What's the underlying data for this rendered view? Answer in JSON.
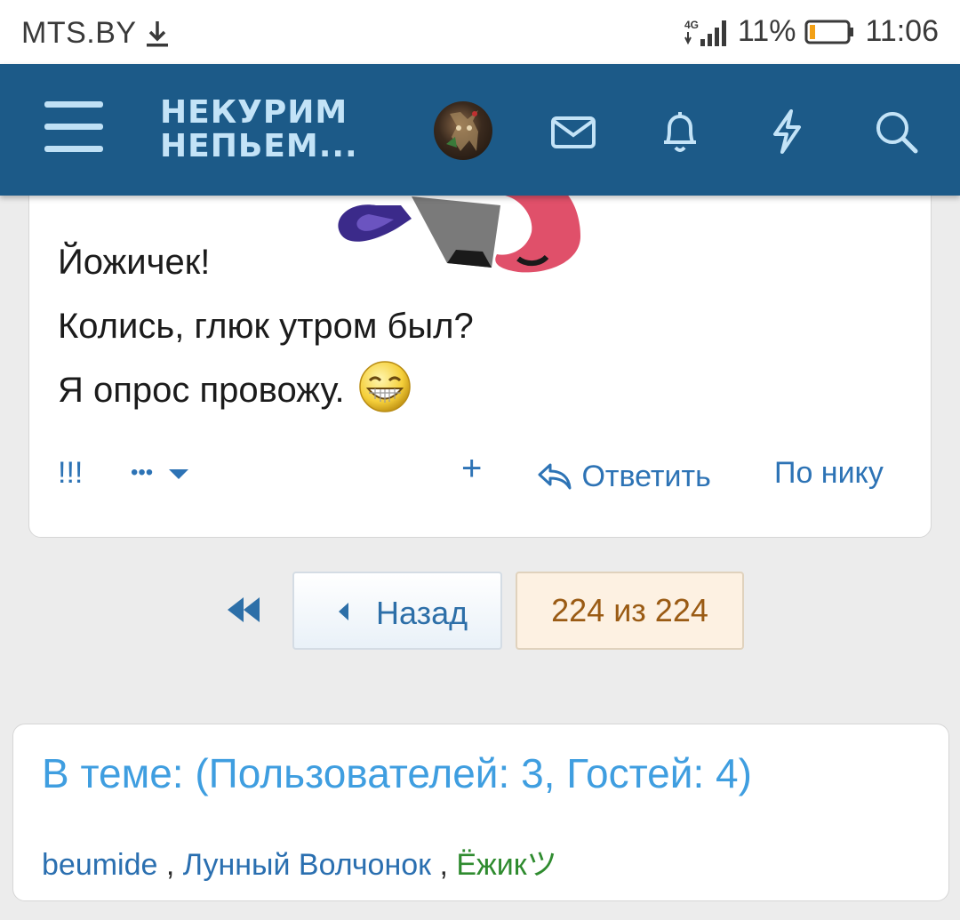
{
  "status_bar": {
    "carrier": "MTS.BY",
    "network": "4G",
    "battery_pct": "11%",
    "battery_level": 0.11,
    "time": "11:06"
  },
  "header": {
    "logo_line1": "НЕКУРИМ",
    "logo_line2": "НЕПЬЕМ...",
    "icons": [
      "menu-icon",
      "avatar",
      "mail-icon",
      "bell-icon",
      "bolt-icon",
      "search-icon"
    ]
  },
  "post": {
    "lines": [
      "Йожичек!",
      "Колись, глюк утром был?",
      "Я опрос провожу."
    ],
    "emoji": "grin-smiley-icon",
    "actions": {
      "exclaim": "!!!",
      "more": "•••",
      "plus": "+",
      "reply": "Ответить",
      "by_nick": "По нику"
    }
  },
  "pagination": {
    "back": "Назад",
    "current": "224 из 224"
  },
  "online": {
    "title": "В теме: (Пользователей: 3, Гостей: 4)",
    "users": [
      "beumide",
      "Лунный Волчонок",
      "Ёжикツ"
    ],
    "separator": " , "
  },
  "colors": {
    "header_bg": "#1c5a88",
    "link": "#2d73b5",
    "online_title": "#3f9ee0",
    "current_page_bg": "#fdf1e2",
    "green_user": "#2f8b2f"
  }
}
